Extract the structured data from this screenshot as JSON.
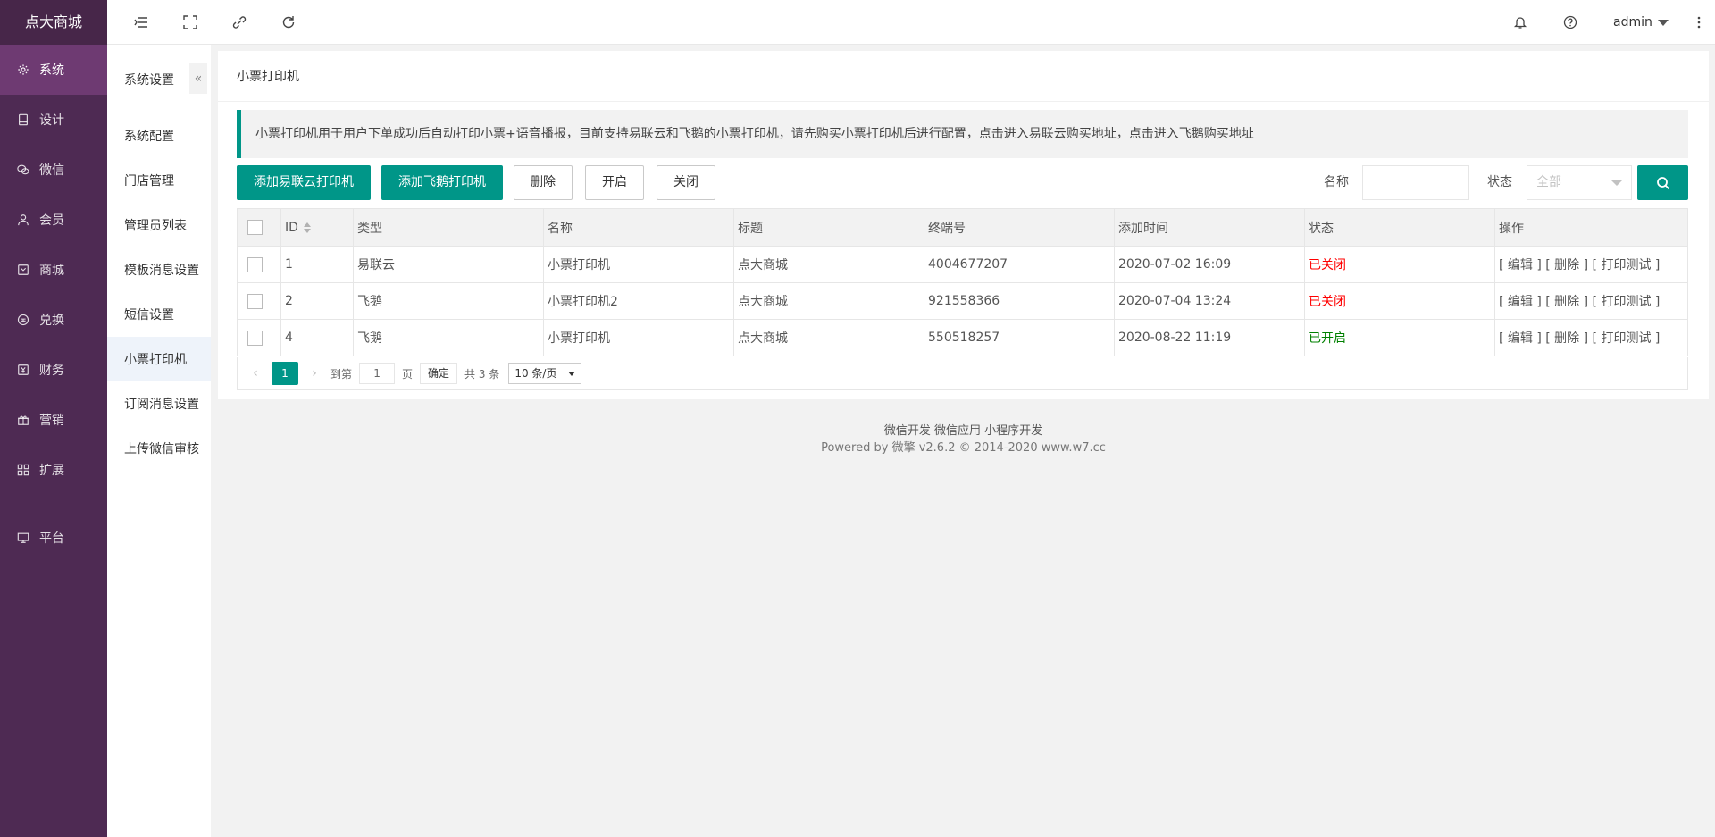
{
  "sidebar": {
    "logo": "点大商城",
    "items": [
      {
        "label": "系统",
        "icon": "gear-icon"
      },
      {
        "label": "设计",
        "icon": "tablet-icon"
      },
      {
        "label": "微信",
        "icon": "wechat-icon"
      },
      {
        "label": "会员",
        "icon": "user-icon"
      },
      {
        "label": "商城",
        "icon": "shop-icon"
      },
      {
        "label": "兑换",
        "icon": "exchange-icon"
      },
      {
        "label": "财务",
        "icon": "finance-icon"
      },
      {
        "label": "营销",
        "icon": "gift-icon"
      },
      {
        "label": "扩展",
        "icon": "grid-icon"
      },
      {
        "label": "平台",
        "icon": "monitor-icon"
      }
    ]
  },
  "header": {
    "user": "admin"
  },
  "submenu": {
    "title": "系统设置",
    "items": [
      "系统配置",
      "门店管理",
      "管理员列表",
      "模板消息设置",
      "短信设置",
      "小票打印机",
      "订阅消息设置",
      "上传微信审核"
    ]
  },
  "page": {
    "title": "小票打印机",
    "notice": "小票打印机用于用户下单成功后自动打印小票+语音播报，目前支持易联云和飞鹅的小票打印机，请先购买小票打印机后进行配置，点击进入易联云购买地址，点击进入飞鹅购买地址"
  },
  "toolbar": {
    "add_yilianyun": "添加易联云打印机",
    "add_feie": "添加飞鹅打印机",
    "delete": "删除",
    "open": "开启",
    "close": "关闭",
    "name_label": "名称",
    "name_value": "",
    "status_label": "状态",
    "status_placeholder": "全部"
  },
  "table": {
    "headers": [
      "ID",
      "类型",
      "名称",
      "标题",
      "终端号",
      "添加时间",
      "状态",
      "操作"
    ],
    "rows": [
      {
        "id": "1",
        "type": "易联云",
        "name": "小票打印机",
        "title": "点大商城",
        "terminal": "4004677207",
        "time": "2020-07-02 16:09",
        "status": "已关闭",
        "status_color": "#ff0000",
        "ops": "[ 编辑 ] [ 删除 ] [ 打印测试 ]"
      },
      {
        "id": "2",
        "type": "飞鹅",
        "name": "小票打印机2",
        "title": "点大商城",
        "terminal": "921558366",
        "time": "2020-07-04 13:24",
        "status": "已关闭",
        "status_color": "#ff0000",
        "ops": "[ 编辑 ] [ 删除 ] [ 打印测试 ]"
      },
      {
        "id": "4",
        "type": "飞鹅",
        "name": "小票打印机",
        "title": "点大商城",
        "terminal": "550518257",
        "time": "2020-08-22 11:19",
        "status": "已开启",
        "status_color": "#008000",
        "ops": "[ 编辑 ] [ 删除 ] [ 打印测试 ]"
      }
    ]
  },
  "pager": {
    "current": "1",
    "goto_label": "到第",
    "goto_value": "1",
    "page_unit": "页",
    "confirm": "确定",
    "total": "共 3 条",
    "page_size": "10 条/页"
  },
  "footer": {
    "links": "微信开发 微信应用 小程序开发",
    "powered": "Powered by 微擎 v2.6.2 © 2014-2020 www.w7.cc"
  }
}
